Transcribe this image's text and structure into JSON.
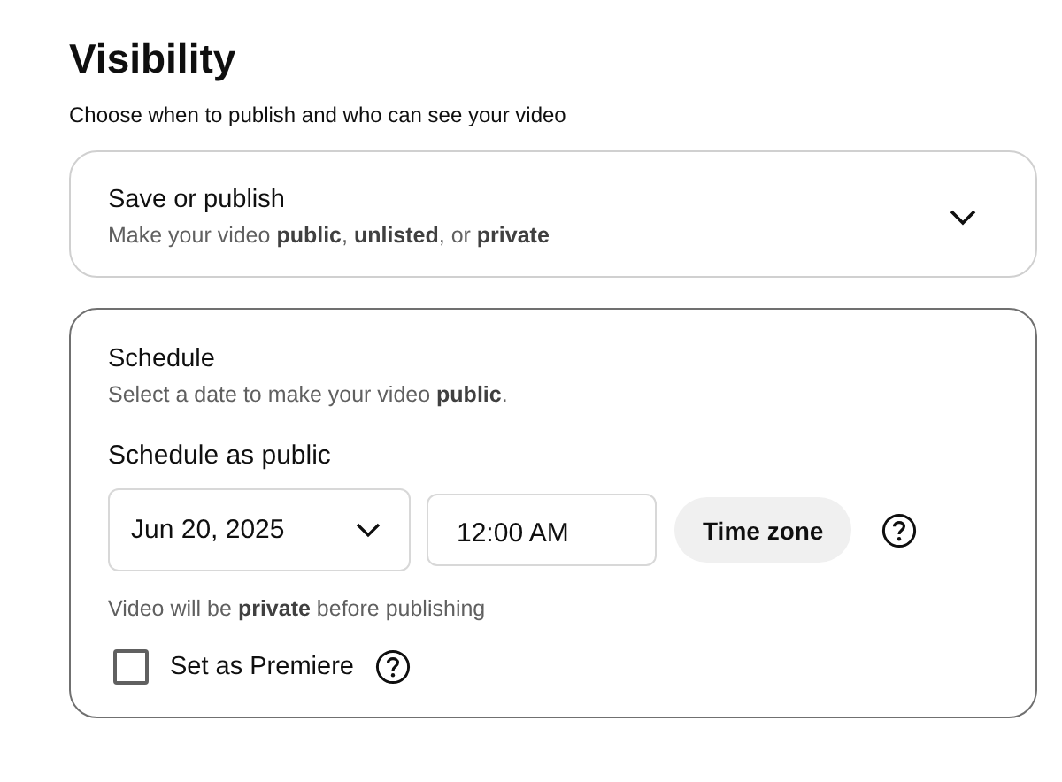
{
  "title": "Visibility",
  "subtitle": "Choose when to publish and who can see your video",
  "save_or_publish": {
    "title": "Save or publish",
    "description": "Make your video **public**, **unlisted**, or **private**",
    "selected": false
  },
  "schedule": {
    "title": "Schedule",
    "description": "Select a date to make your video **public**.",
    "selected": true,
    "label": "Schedule as public",
    "date": "Jun 20, 2025",
    "time": "12:00 AM",
    "timezone_button": "Time zone",
    "note": "Video will be **private** before publishing",
    "premiere": {
      "label": "Set as Premiere",
      "checked": false
    }
  }
}
